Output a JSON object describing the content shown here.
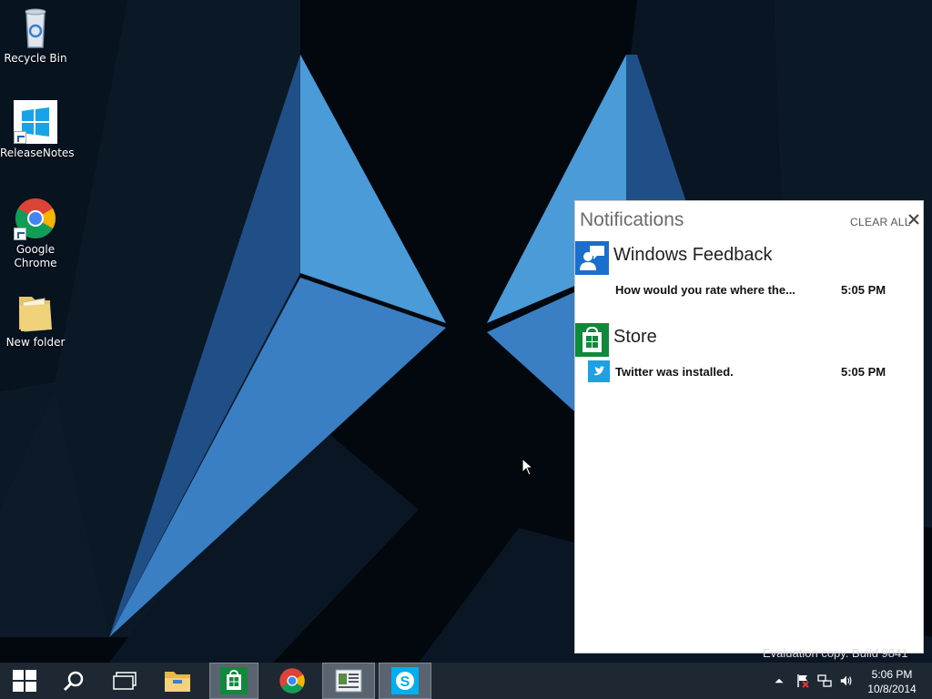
{
  "desktop_icons": [
    {
      "label": "Recycle Bin",
      "icon": "recycle-bin-icon"
    },
    {
      "label": "ReleaseNotes",
      "icon": "windows-logo-icon"
    },
    {
      "label": "Google\nChrome",
      "icon": "chrome-icon"
    },
    {
      "label": "New folder",
      "icon": "folder-icon"
    }
  ],
  "notifications": {
    "title": "Notifications",
    "clear_all": "CLEAR ALL",
    "groups": [
      {
        "app": "Windows Feedback",
        "icon": "feedback-icon",
        "items": [
          {
            "text": "How would you rate where the...",
            "time": "5:05 PM"
          }
        ]
      },
      {
        "app": "Store",
        "icon": "store-icon",
        "items": [
          {
            "text": "Twitter was installed.",
            "time": "5:05 PM",
            "icon": "twitter-icon"
          }
        ]
      }
    ]
  },
  "watermark": "Evaluation copy. Build 9841",
  "taskbar": {
    "buttons": [
      "start-icon",
      "search-icon",
      "task-view-icon",
      "file-explorer-icon",
      "store-icon",
      "chrome-icon",
      "app-window-icon",
      "skype-icon"
    ],
    "clock": {
      "time": "5:06 PM",
      "date": "10/8/2014"
    }
  },
  "colors": {
    "accent": "#4a9bd8",
    "taskbar": "#1e2832",
    "store_green": "#0f8a3a",
    "feedback_blue": "#1b6fcc",
    "twitter_blue": "#1da1e2"
  }
}
